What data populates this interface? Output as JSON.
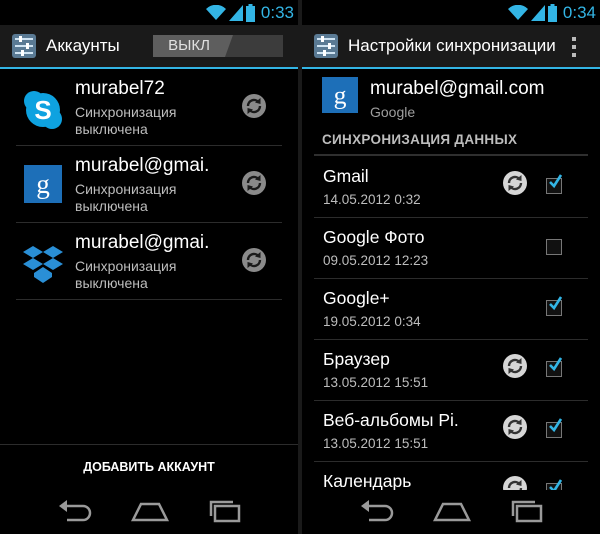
{
  "colors": {
    "accent": "#33b5e5",
    "background": "#000000",
    "secondary_text": "#bdbdbd"
  },
  "left": {
    "statusbar": {
      "time": "0:33"
    },
    "actionbar": {
      "title": "Аккаунты",
      "toggle_label": "ВЫКЛ"
    },
    "accounts": [
      {
        "name": "murabel72",
        "status": "Синхронизация выключена",
        "icon": "skype-icon"
      },
      {
        "name": "murabel@gmai.",
        "status": "Синхронизация выключена",
        "icon": "google-icon"
      },
      {
        "name": "murabel@gmai.",
        "status": "Синхронизация выключена",
        "icon": "dropbox-icon"
      }
    ],
    "add_account_label": "ДОБАВИТЬ АККАУНТ"
  },
  "right": {
    "statusbar": {
      "time": "0:34"
    },
    "actionbar": {
      "title": "Настройки синхронизации"
    },
    "account": {
      "email": "murabel@gmail.com",
      "type": "Google"
    },
    "section_title": "СИНХРОНИЗАЦИЯ ДАННЫХ",
    "items": [
      {
        "name": "Gmail",
        "date": "14.05.2012 0:32",
        "checked": true,
        "syncing": true
      },
      {
        "name": "Google Фото",
        "date": "09.05.2012 12:23",
        "checked": false,
        "syncing": false
      },
      {
        "name": "Google+",
        "date": "19.05.2012 0:34",
        "checked": true,
        "syncing": false
      },
      {
        "name": "Браузер",
        "date": "13.05.2012 15:51",
        "checked": true,
        "syncing": true
      },
      {
        "name": "Веб-альбомы Pi.",
        "date": "13.05.2012 15:51",
        "checked": true,
        "syncing": true
      },
      {
        "name": "Календарь",
        "date": "",
        "checked": true,
        "syncing": true
      }
    ]
  }
}
